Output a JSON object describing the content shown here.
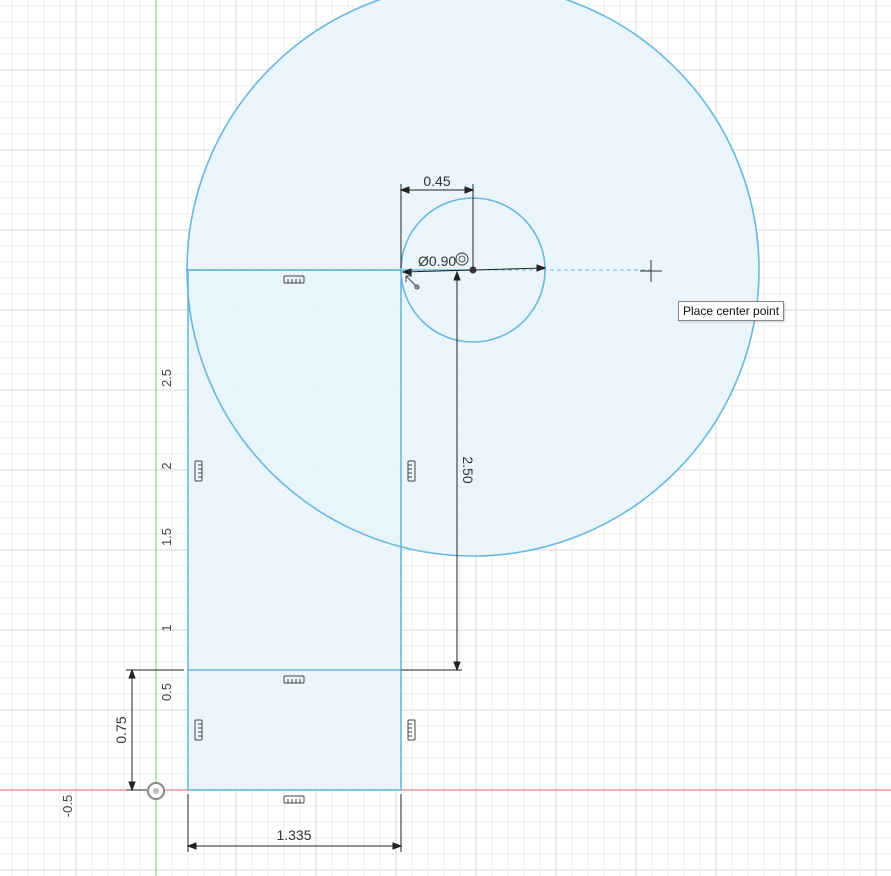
{
  "tooltip": {
    "text": "Place center point"
  },
  "dimensions": {
    "small_offset": "0.45",
    "small_diameter": "Ø0.90",
    "vertical_long": "2.50",
    "bottom_height": "0.75",
    "width": "1.335"
  },
  "axis_labels": {
    "y_25": "2.5",
    "y_2": "2",
    "y_15": "1.5",
    "y_1": "1",
    "y_05": "0.5",
    "neg_05": "-0.5"
  },
  "colors": {
    "sketch_line": "#69b8dd",
    "profile_fill": "#e8f4fb",
    "grid_minor": "#ececec",
    "grid_major": "#d9d9d9",
    "x_axis": "#e06666",
    "y_axis": "#8fd68f",
    "dimension": "#222222"
  }
}
